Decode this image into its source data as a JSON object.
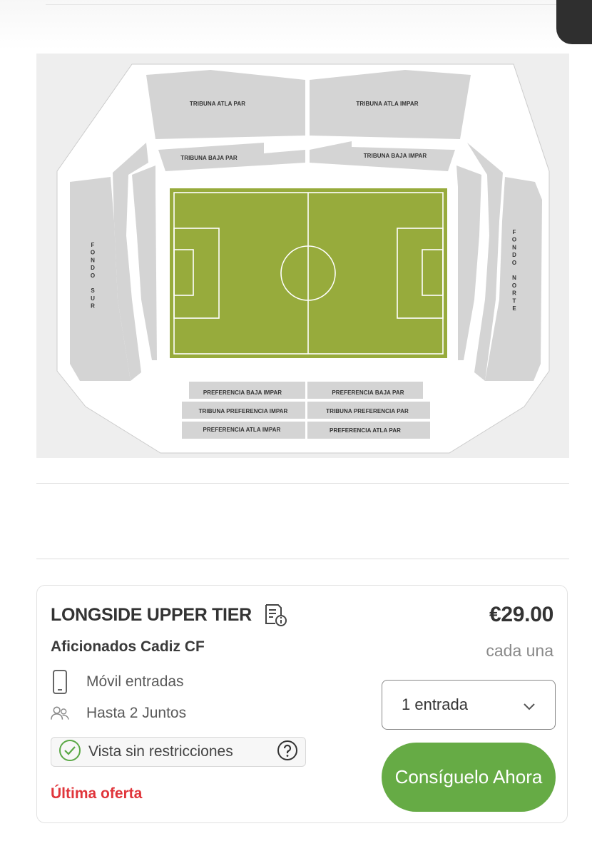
{
  "stadium_map": {
    "sections": {
      "tribuna_atla_par": "TRIBUNA ATLA PAR",
      "tribuna_atla_impar": "TRIBUNA ATLA IMPAR",
      "tribuna_baja_par": "TRIBUNA BAJA PAR",
      "tribuna_baja_impar": "TRIBUNA BAJA IMPAR",
      "fondo_sur": [
        "F",
        "O",
        "N",
        "D",
        "O",
        "",
        "S",
        "U",
        "R"
      ],
      "fondo_norte": [
        "F",
        "O",
        "N",
        "D",
        "O",
        "",
        "N",
        "O",
        "R",
        "T",
        "E"
      ],
      "preferencia_baja_impar": "PREFERENCIA BAJA IMPAR",
      "preferencia_baja_par": "PREFERENCIA BAJA PAR",
      "tribuna_preferencia_impar": "TRIBUNA PREFERENCIA IMPAR",
      "tribuna_preferencia_par": "TRIBUNA PREFERENCIA PAR",
      "preferencia_atla_impar": "PREFERENCIA ATLA IMPAR",
      "preferencia_atla_par": "PREFERENCIA ATLA PAR"
    },
    "colors": {
      "pitch": "#97ab3c",
      "stand": "#d4d4d4",
      "background": "#eeeeee"
    }
  },
  "listing": {
    "section_name": "LONGSIDE UPPER TIER",
    "section_icon": "ticket-info-icon",
    "seller_type": "Aficionados Cadiz CF",
    "features": [
      {
        "icon": "mobile-phone-icon",
        "label": "Móvil entradas"
      },
      {
        "icon": "people-icon",
        "label": "Hasta 2 Juntos"
      }
    ],
    "view_badge": {
      "icon": "check-circle-icon",
      "label": "Vista sin restricciones",
      "help_icon": "question-circle-icon"
    },
    "last_offer": "Última oferta",
    "price": "€29.00",
    "price_unit": "cada una",
    "quantity": {
      "selected": "1 entrada"
    },
    "cta_label": "Consíguelo Ahora",
    "colors": {
      "cta": "#66ab45",
      "alert": "#e0353b"
    }
  }
}
